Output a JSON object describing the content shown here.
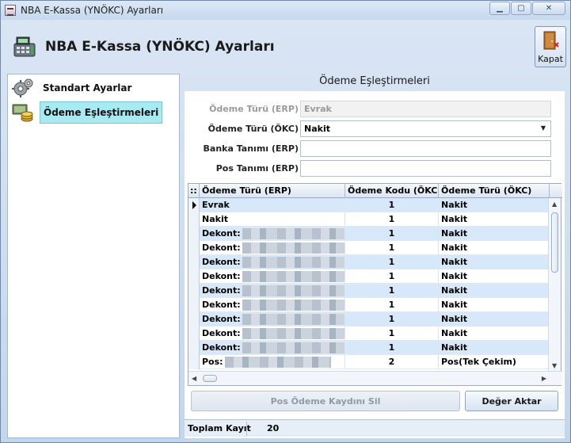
{
  "window": {
    "title": "NBA E-Kassa (YNÖKC) Ayarları",
    "controls": {
      "minimize": "▁",
      "maximize": "▢",
      "close": "✕"
    }
  },
  "header": {
    "title": "NBA E-Kassa (YNÖKC) Ayarları",
    "close_label": "Kapat",
    "icon": "cash-register-icon"
  },
  "nav": {
    "items": [
      {
        "label": "Standart Ayarlar",
        "icon": "gears-icon",
        "selected": false
      },
      {
        "label": "Ödeme Eşleştirmeleri",
        "icon": "coins-icon",
        "selected": true
      }
    ]
  },
  "section": {
    "title": "Ödeme Eşleştirmeleri"
  },
  "form": {
    "erp_payment_type": {
      "label": "Ödeme Türü (ERP)",
      "value": "Evrak",
      "disabled": true
    },
    "okc_payment_type": {
      "label": "Ödeme Türü (ÖKC)",
      "value": "Nakit"
    },
    "bank_definition": {
      "label": "Banka Tanımı (ERP)",
      "value": ""
    },
    "pos_definition": {
      "label": "Pos Tanımı (ERP)",
      "value": ""
    }
  },
  "grid": {
    "corner": "::",
    "columns": [
      "Ödeme Türü (ERP)",
      "Ödeme Kodu (ÖKC)",
      "Ödeme Türü (ÖKC)"
    ],
    "rows": [
      {
        "erp": "Evrak",
        "code": "1",
        "okc": "Nakit",
        "current": true
      },
      {
        "erp": "Nakit",
        "code": "1",
        "okc": "Nakit"
      },
      {
        "erp": "Dekont:",
        "code": "1",
        "okc": "Nakit",
        "redacted": true
      },
      {
        "erp": "Dekont:",
        "code": "1",
        "okc": "Nakit",
        "redacted": true
      },
      {
        "erp": "Dekont:",
        "code": "1",
        "okc": "Nakit",
        "redacted": true
      },
      {
        "erp": "Dekont:",
        "code": "1",
        "okc": "Nakit",
        "redacted": true
      },
      {
        "erp": "Dekont:",
        "code": "1",
        "okc": "Nakit",
        "redacted": true
      },
      {
        "erp": "Dekont:",
        "code": "1",
        "okc": "Nakit",
        "redacted": true
      },
      {
        "erp": "Dekont:",
        "code": "1",
        "okc": "Nakit",
        "redacted": true
      },
      {
        "erp": "Dekont:",
        "code": "1",
        "okc": "Nakit",
        "redacted": true
      },
      {
        "erp": "Dekont:",
        "code": "1",
        "okc": "Nakit",
        "redacted": true
      },
      {
        "erp": "Pos:",
        "code": "2",
        "okc": "Pos(Tek Çekim)",
        "redacted": true
      }
    ]
  },
  "buttons": {
    "delete_pos": "Pos Ödeme Kaydını Sil",
    "transfer": "Değer Aktar"
  },
  "status": {
    "label": "Toplam Kayıt",
    "value": "20"
  }
}
